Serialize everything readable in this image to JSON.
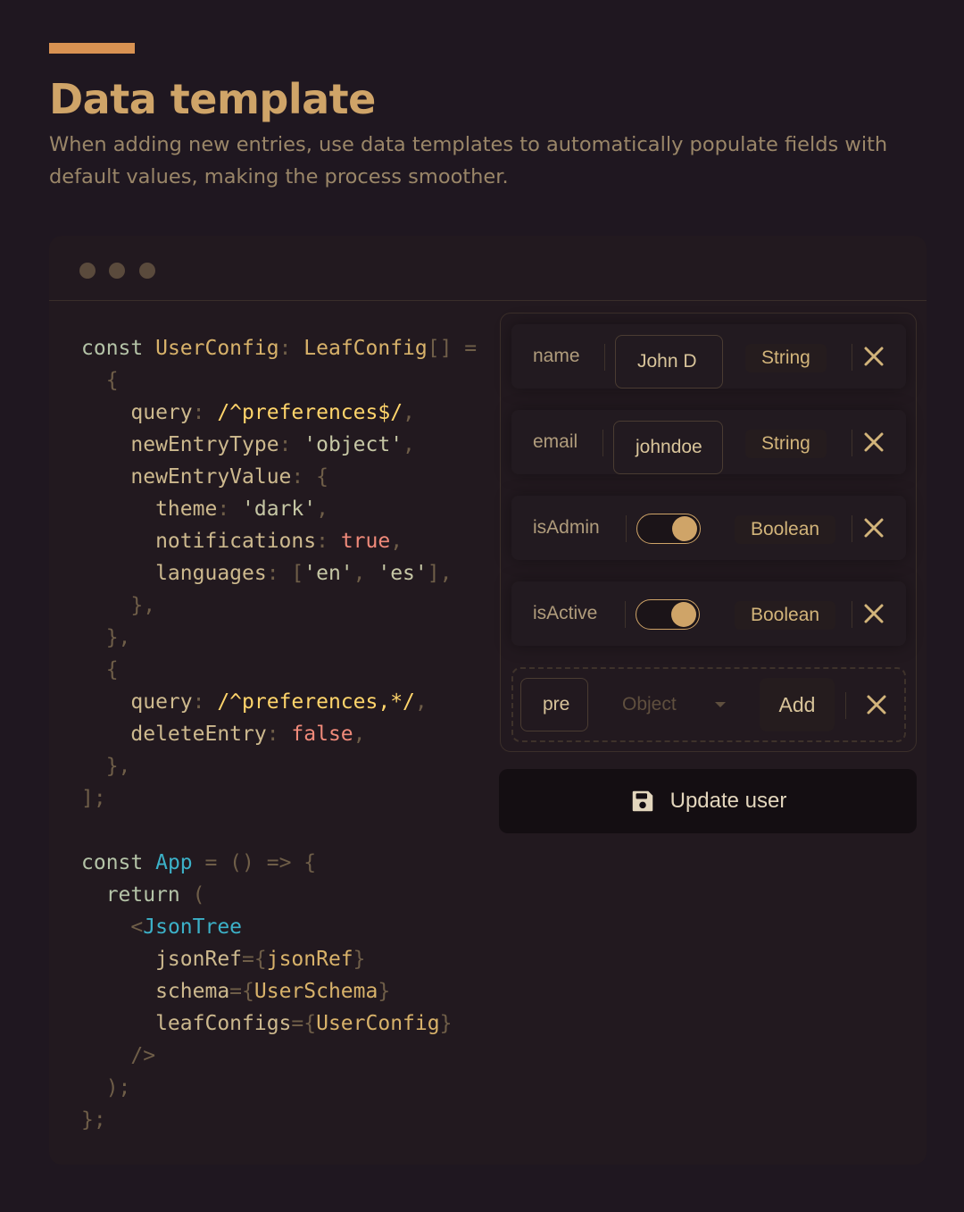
{
  "header": {
    "title": "Data template",
    "subtitle": "When adding new entries, use data templates to automatically populate fields with default values, making the process smoother."
  },
  "colors": {
    "accent": "#d89252",
    "title": "#cfa468",
    "background": "#1f1720",
    "toggle_on": "#cfa468"
  },
  "window": {
    "controls": [
      "dot-1",
      "dot-2",
      "dot-3"
    ]
  },
  "code_lines": [
    [
      [
        "kw",
        "const "
      ],
      [
        "type",
        "UserConfig"
      ],
      [
        "pun",
        ": "
      ],
      [
        "type",
        "LeafConfig"
      ],
      [
        "pun",
        "[] ="
      ]
    ],
    [
      [
        "pun",
        "  {"
      ]
    ],
    [
      [
        "prop",
        "    query"
      ],
      [
        "pun",
        ": "
      ],
      [
        "rx",
        "/^preferences$/"
      ],
      [
        "pun",
        ","
      ]
    ],
    [
      [
        "prop",
        "    newEntryType"
      ],
      [
        "pun",
        ": "
      ],
      [
        "str",
        "'object'"
      ],
      [
        "pun",
        ","
      ]
    ],
    [
      [
        "prop",
        "    newEntryValue"
      ],
      [
        "pun",
        ": {"
      ]
    ],
    [
      [
        "prop",
        "      theme"
      ],
      [
        "pun",
        ": "
      ],
      [
        "str",
        "'dark'"
      ],
      [
        "pun",
        ","
      ]
    ],
    [
      [
        "prop",
        "      notifications"
      ],
      [
        "pun",
        ": "
      ],
      [
        "bool",
        "true"
      ],
      [
        "pun",
        ","
      ]
    ],
    [
      [
        "prop",
        "      languages"
      ],
      [
        "pun",
        ": ["
      ],
      [
        "str",
        "'en'"
      ],
      [
        "pun",
        ", "
      ],
      [
        "str",
        "'es'"
      ],
      [
        "pun",
        "],"
      ]
    ],
    [
      [
        "pun",
        "    },"
      ]
    ],
    [
      [
        "pun",
        "  },"
      ]
    ],
    [
      [
        "pun",
        "  {"
      ]
    ],
    [
      [
        "prop",
        "    query"
      ],
      [
        "pun",
        ": "
      ],
      [
        "rx",
        "/^preferences,*/"
      ],
      [
        "pun",
        ","
      ]
    ],
    [
      [
        "prop",
        "    deleteEntry"
      ],
      [
        "pun",
        ": "
      ],
      [
        "bool",
        "false"
      ],
      [
        "pun",
        ","
      ]
    ],
    [
      [
        "pun",
        "  },"
      ]
    ],
    [
      [
        "pun",
        "];"
      ]
    ],
    [
      [
        "pun",
        ""
      ]
    ],
    [
      [
        "kw",
        "const "
      ],
      [
        "name",
        "App"
      ],
      [
        "pun",
        " = () => {"
      ]
    ],
    [
      [
        "kw",
        "  return "
      ],
      [
        "pun",
        "("
      ]
    ],
    [
      [
        "pun",
        "    <"
      ],
      [
        "comp",
        "JsonTree"
      ]
    ],
    [
      [
        "prop",
        "      jsonRef"
      ],
      [
        "pun",
        "={"
      ],
      [
        "type",
        "jsonRef"
      ],
      [
        "pun",
        "}"
      ]
    ],
    [
      [
        "prop",
        "      schema"
      ],
      [
        "pun",
        "={"
      ],
      [
        "type",
        "UserSchema"
      ],
      [
        "pun",
        "}"
      ]
    ],
    [
      [
        "prop",
        "      leafConfigs"
      ],
      [
        "pun",
        "={"
      ],
      [
        "type",
        "UserConfig"
      ],
      [
        "pun",
        "}"
      ]
    ],
    [
      [
        "pun",
        "    />"
      ]
    ],
    [
      [
        "pun",
        "  );"
      ]
    ],
    [
      [
        "pun",
        "};"
      ]
    ]
  ],
  "entries": [
    {
      "key": "name",
      "value": "John D",
      "type": "String",
      "kind": "text"
    },
    {
      "key": "email",
      "value": "johndoe",
      "type": "String",
      "kind": "text"
    },
    {
      "key": "isAdmin",
      "value": true,
      "type": "Boolean",
      "kind": "toggle"
    },
    {
      "key": "isActive",
      "value": true,
      "type": "Boolean",
      "kind": "toggle"
    }
  ],
  "new_entry": {
    "key_value": "pre",
    "type_placeholder": "Object",
    "add_label": "Add"
  },
  "update_button": {
    "label": "Update user",
    "icon": "save-icon"
  }
}
